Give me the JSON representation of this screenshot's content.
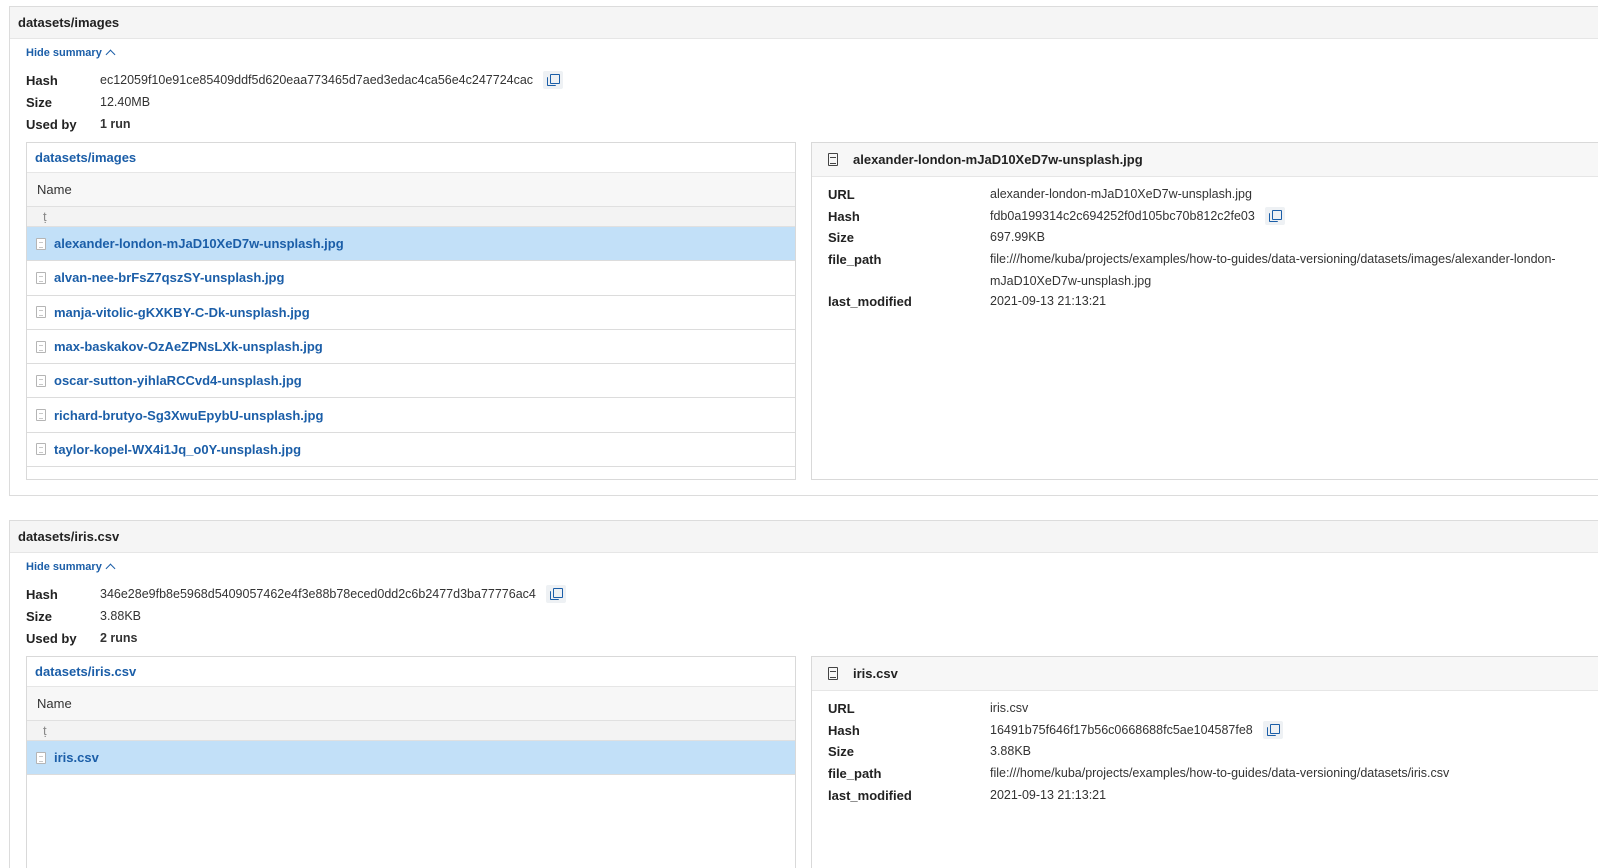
{
  "artifacts": [
    {
      "title": "datasets/images",
      "toggle_label": "Hide summary",
      "summary": {
        "hash_label": "Hash",
        "hash": "ec12059f10e91ce85409ddf5d620eaa773465d7aed3edac4ca56e4c247724cac",
        "size_label": "Size",
        "size": "12.40MB",
        "used_by_label": "Used by",
        "used_by": "1 run"
      },
      "browser": {
        "path": "datasets/images",
        "column_header": "Name",
        "up_glyph": "ṭ",
        "files": [
          "alexander-london-mJaD10XeD7w-unsplash.jpg",
          "alvan-nee-brFsZ7qszSY-unsplash.jpg",
          "manja-vitolic-gKXKBY-C-Dk-unsplash.jpg",
          "max-baskakov-OzAeZPNsLXk-unsplash.jpg",
          "oscar-sutton-yihlaRCCvd4-unsplash.jpg",
          "richard-brutyo-Sg3XwuEpybU-unsplash.jpg",
          "taylor-kopel-WX4i1Jq_o0Y-unsplash.jpg"
        ],
        "selected": "alexander-london-mJaD10XeD7w-unsplash.jpg"
      },
      "details": {
        "title": "alexander-london-mJaD10XeD7w-unsplash.jpg",
        "url_label": "URL",
        "url": "alexander-london-mJaD10XeD7w-unsplash.jpg",
        "hash_label": "Hash",
        "hash": "fdb0a199314c2c694252f0d105bc70b812c2fe03",
        "size_label": "Size",
        "size": "697.99KB",
        "file_path_label": "file_path",
        "file_path": "file:///home/kuba/projects/examples/how-to-guides/data-versioning/datasets/images/alexander-london-mJaD10XeD7w-unsplash.jpg",
        "last_modified_label": "last_modified",
        "last_modified": "2021-09-13 21:13:21"
      }
    },
    {
      "title": "datasets/iris.csv",
      "toggle_label": "Hide summary",
      "summary": {
        "hash_label": "Hash",
        "hash": "346e28e9fb8e5968d5409057462e4f3e88b78eced0dd2c6b2477d3ba77776ac4",
        "size_label": "Size",
        "size": "3.88KB",
        "used_by_label": "Used by",
        "used_by": "2 runs"
      },
      "browser": {
        "path": "datasets/iris.csv",
        "column_header": "Name",
        "up_glyph": "ṭ",
        "files": [
          "iris.csv"
        ],
        "selected": "iris.csv"
      },
      "details": {
        "title": "iris.csv",
        "url_label": "URL",
        "url": "iris.csv",
        "hash_label": "Hash",
        "hash": "16491b75f646f17b56c0668688fc5ae104587fe8",
        "size_label": "Size",
        "size": "3.88KB",
        "file_path_label": "file_path",
        "file_path": "file:///home/kuba/projects/examples/how-to-guides/data-versioning/datasets/iris.csv",
        "last_modified_label": "last_modified",
        "last_modified": "2021-09-13 21:13:21"
      }
    }
  ],
  "colors": {
    "link": "#1b5ea8",
    "selected_row": "#c2e0f8",
    "header_bg": "#f5f5f5",
    "border": "#dcdcdc"
  },
  "icons": {
    "copy": "copy-icon",
    "file": "file-icon",
    "document": "document-icon",
    "chevron": "chevron-up-icon"
  }
}
